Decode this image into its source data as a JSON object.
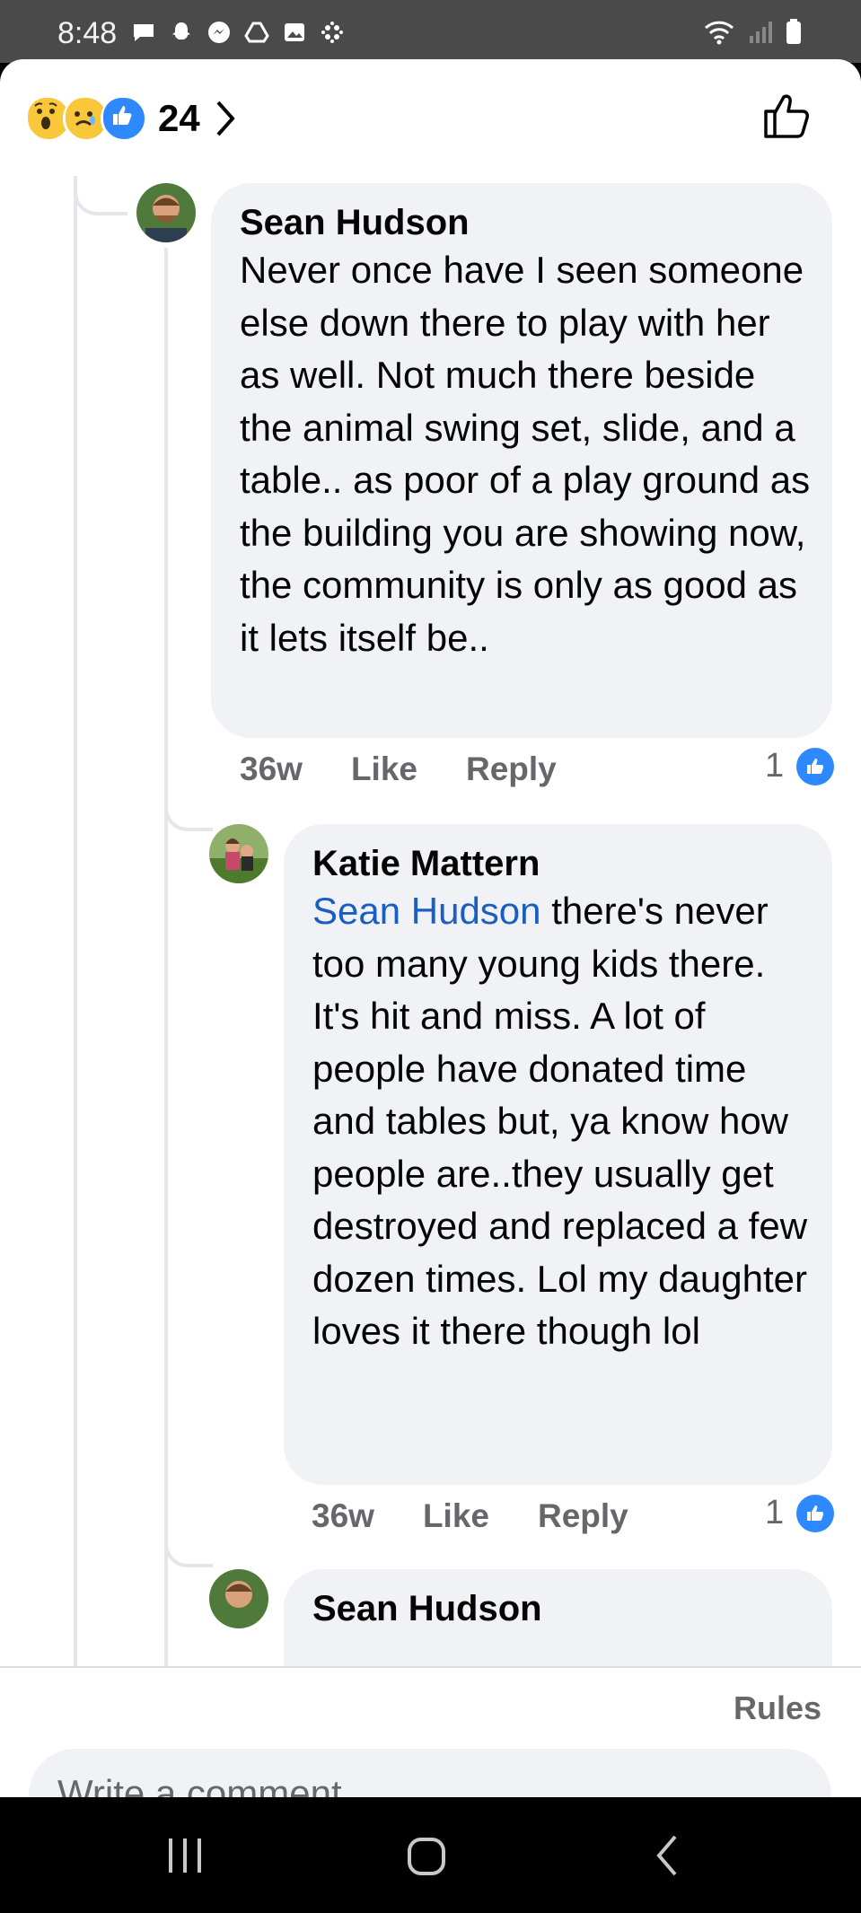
{
  "status_bar": {
    "time": "8:48"
  },
  "header": {
    "reaction_count": "24",
    "reaction_icons": [
      "wow-emoji",
      "sad-emoji",
      "like-reaction"
    ],
    "like_button_icon": "thumbs-up-outline-icon"
  },
  "comments": [
    {
      "author": "Sean Hudson",
      "text": "Never once have I seen someone else down there to play with her as well. Not much there beside the animal swing set, slide, and a table.. as poor of a play ground as the building you are showing now, the community is only as good as it lets itself be..",
      "time": "36w",
      "like_label": "Like",
      "reply_label": "Reply",
      "likes": "1"
    },
    {
      "author": "Katie Mattern",
      "mention": "Sean Hudson",
      "text": " there's never too many young kids there. It's hit and miss. A lot of people have donated time and tables but, ya know how people are..they usually get destroyed and replaced a few dozen times. Lol my daughter loves it there though lol",
      "time": "36w",
      "like_label": "Like",
      "reply_label": "Reply",
      "likes": "1"
    },
    {
      "author": "Sean Hudson"
    }
  ],
  "footer": {
    "rules_label": "Rules",
    "comment_placeholder": "Write a comment…"
  },
  "colors": {
    "accent": "#1877f2",
    "bubble": "#f0f2f5",
    "mention": "#1a5ec2",
    "muted": "#65676b"
  }
}
